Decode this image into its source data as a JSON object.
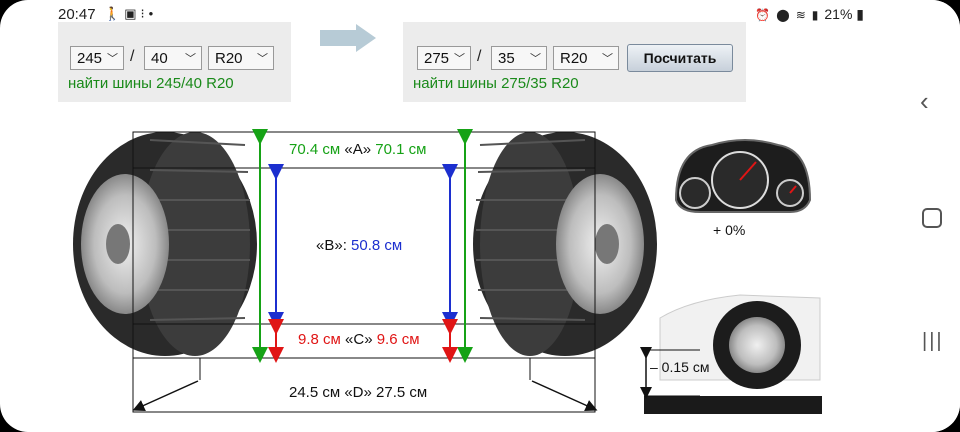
{
  "status_bar": {
    "time": "20:47",
    "battery": "21%"
  },
  "left_panel": {
    "width_value": "245",
    "profile_value": "40",
    "rim_value": "R20",
    "separator": "/",
    "find_link": "найти шины 245/40 R20"
  },
  "right_panel": {
    "width_value": "275",
    "profile_value": "35",
    "rim_value": "R20",
    "separator": "/",
    "calculate_button": "Посчитать",
    "find_link": "найти шины 275/35 R20"
  },
  "diagram": {
    "a_label_left": "70.4 см",
    "a_label_mid": "«A»",
    "a_label_right": "70.1 см",
    "b_label": "«B»:",
    "b_value": "50.8 см",
    "c_label_left": "9.8 см",
    "c_label_mid": "«C»",
    "c_label_right": "9.6 см",
    "d_label": "24.5 см «D» 27.5 см",
    "speed_change": "+ 0%",
    "clearance_change": "– 0.15 см"
  },
  "colors": {
    "green": "#16a216",
    "blue": "#1c2fcf",
    "red": "#e01515",
    "link": "#1a8a1a"
  },
  "icons": [
    "back-icon",
    "home-icon",
    "recents-icon",
    "alarm-icon",
    "location-icon",
    "wifi-icon",
    "signal-icon",
    "battery-icon",
    "arrow-right-icon",
    "chevron-down-icon",
    "speedometer-icon"
  ]
}
